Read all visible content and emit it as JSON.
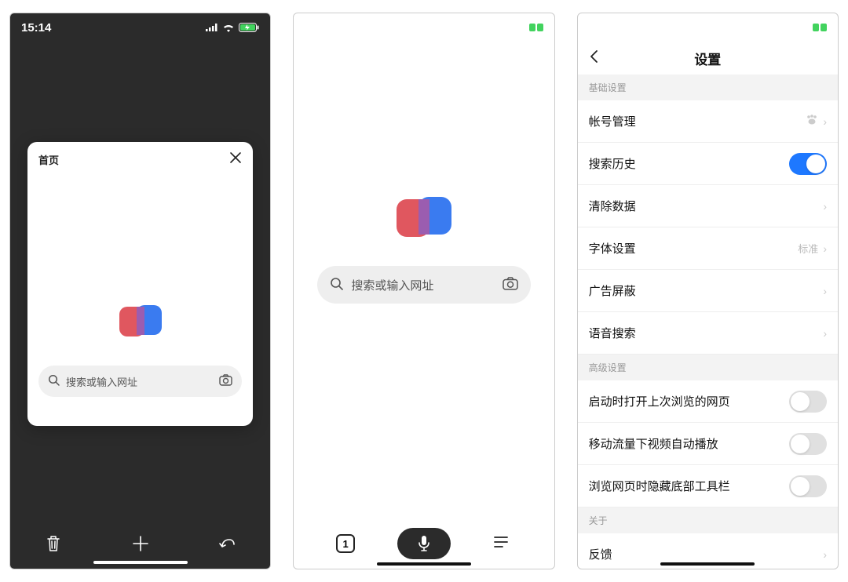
{
  "screen1": {
    "time": "15:14",
    "card_title": "首页",
    "search_placeholder": "搜索或输入网址"
  },
  "screen2": {
    "search_placeholder": "搜索或输入网址",
    "tab_count": "1"
  },
  "screen3": {
    "title": "设置",
    "sections": {
      "basic_header": "基础设置",
      "advanced_header": "高级设置",
      "about_header": "关于"
    },
    "rows": {
      "account": "帐号管理",
      "search_history": "搜索历史",
      "clear_data": "清除数据",
      "font_settings": "字体设置",
      "font_value": "标准",
      "ad_block": "广告屏蔽",
      "voice_search": "语音搜索",
      "restore_tabs": "启动时打开上次浏览的网页",
      "autoplay_cellular": "移动流量下视频自动播放",
      "hide_toolbar": "浏览网页时隐藏底部工具栏",
      "feedback": "反馈"
    },
    "toggles": {
      "search_history": true,
      "restore_tabs": false,
      "autoplay_cellular": false,
      "hide_toolbar": false
    }
  },
  "colors": {
    "accent_green": "#42d35e",
    "accent_blue": "#1e78ff",
    "logo_red": "#e0575f",
    "logo_blue": "#3a7bf0"
  }
}
